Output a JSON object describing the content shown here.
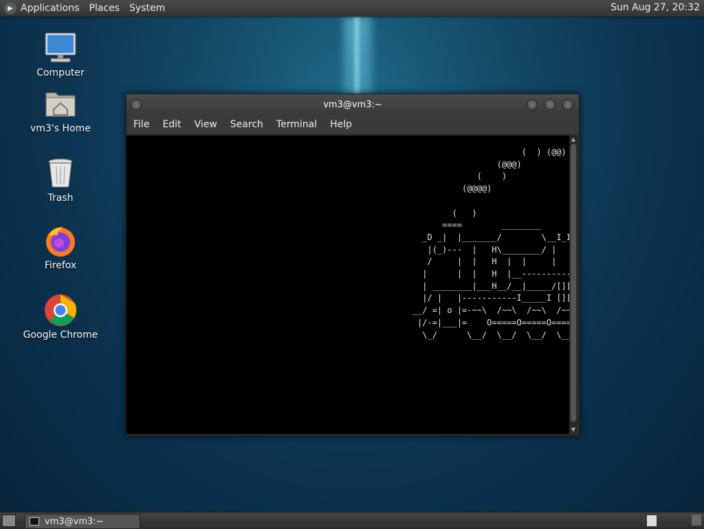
{
  "top_panel": {
    "menus": [
      "Applications",
      "Places",
      "System"
    ],
    "clock": "Sun Aug 27, 20:32"
  },
  "desktop": {
    "icons": [
      {
        "label": "Computer",
        "icon": "computer-icon"
      },
      {
        "label": "vm3's Home",
        "icon": "home-folder-icon"
      },
      {
        "label": "Trash",
        "icon": "trash-icon"
      },
      {
        "label": "Firefox",
        "icon": "firefox-icon"
      },
      {
        "label": "Google Chrome",
        "icon": "chrome-icon"
      }
    ]
  },
  "terminal": {
    "title": "vm3@vm3:~",
    "menu": [
      "File",
      "Edit",
      "View",
      "Search",
      "Terminal",
      "Help"
    ],
    "output": "                                                                               (  ) (@@) ( )  (@)  ()    @@    O     @     O     @\n                                                                          (@@@)\n                                                                      (    )\n                                                                   (@@@@)\n\n                                                                 (   )\n                                                               ====        ________                ___________\n                                                           _D _|  |_______/        \\__I_I_____===__|_________|\n                                                            |(_)---  |   H\\________/ |   |        =|___ ___|\n                                                            /     |  |   H  |  |     |   |         ||_| |_||\n                                                           |      |  |   H  |__--------------------| [___] |\n                                                           | ________|___H__/__|_____/[][]~\\_______|       |\n                                                           |/ |   |-----------I_____I [][] []  D   |=======|__\n                                                         __/ =| o |=-~~\\  /~~\\  /~~\\  /~~\\ ____Y___________|__\n                                                          |/-=|___|=    O=====O=====O=====O|_____/~\\___/\n                                                           \\_/      \\__/  \\__/  \\__/  \\__/      \\_/"
  },
  "taskbar": {
    "task_label": "vm3@vm3:~"
  }
}
